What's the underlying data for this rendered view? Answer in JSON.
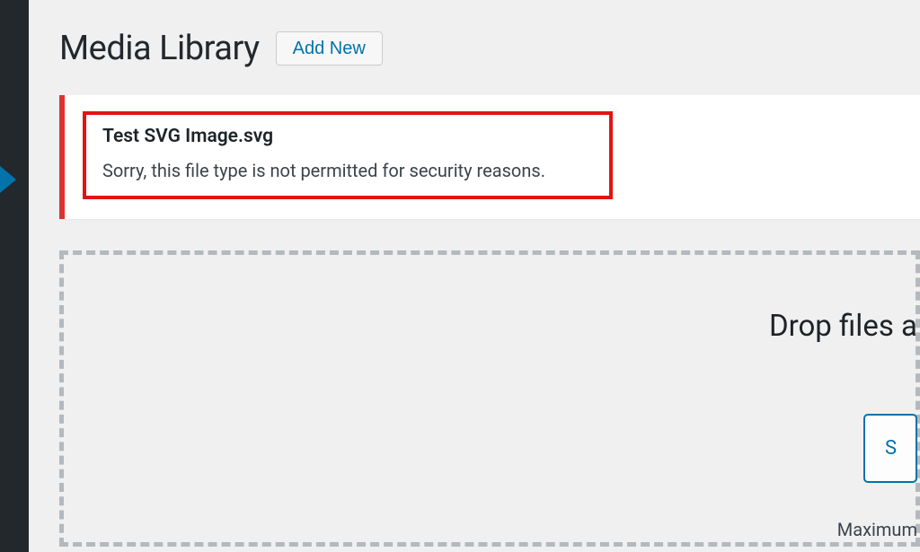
{
  "header": {
    "title": "Media Library",
    "add_new_label": "Add New"
  },
  "notice": {
    "filename": "Test SVG Image.svg",
    "message": "Sorry, this file type is not permitted for security reasons."
  },
  "dropzone": {
    "heading": "Drop files a",
    "select_label": "S",
    "max_label": "Maximum "
  }
}
